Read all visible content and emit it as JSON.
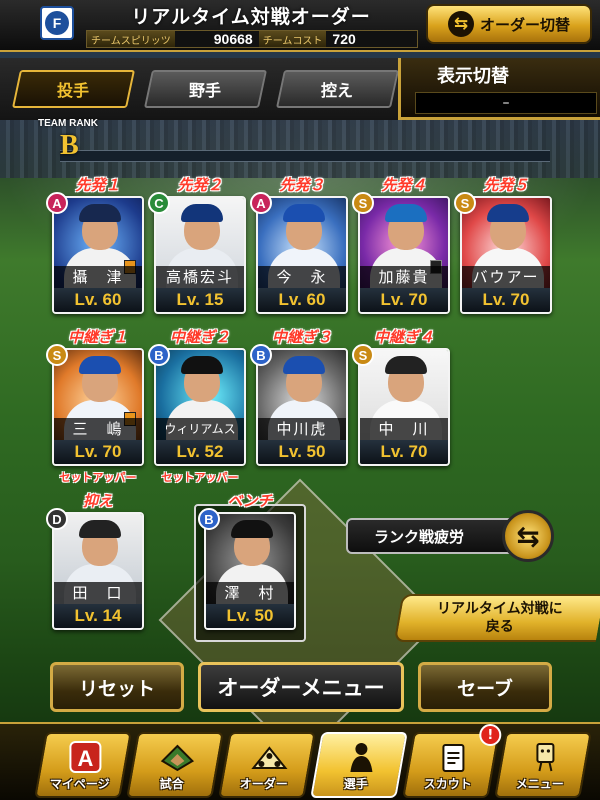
{
  "header": {
    "title": "リアルタイム対戦オーダー",
    "team_spirits_label": "チームスピリッツ",
    "team_spirits_value": "90668",
    "team_cost_label": "チームコスト",
    "team_cost_value": "720",
    "order_switch_label": "オーダー切替"
  },
  "tabs": [
    {
      "label": "投手",
      "active": true
    },
    {
      "label": "野手",
      "active": false
    },
    {
      "label": "控え",
      "active": false
    }
  ],
  "display_toggle": {
    "label": "表示切替",
    "value": "–"
  },
  "team_rank": {
    "label": "TEAM RANK",
    "value": "B"
  },
  "starters": [
    {
      "slot": "先発１",
      "name": "攝　津",
      "level": "Lv. 60",
      "rank": "A"
    },
    {
      "slot": "先発２",
      "name": "高橋宏斗",
      "level": "Lv. 15",
      "rank": "C"
    },
    {
      "slot": "先発３",
      "name": "今　永",
      "level": "Lv. 60",
      "rank": "A"
    },
    {
      "slot": "先発４",
      "name": "加藤貴",
      "level": "Lv. 70",
      "rank": "S"
    },
    {
      "slot": "先発５",
      "name": "バウアー",
      "level": "Lv. 70",
      "rank": "S"
    }
  ],
  "relievers": [
    {
      "slot": "中継ぎ１",
      "name": "三　嶋",
      "level": "Lv. 70",
      "rank": "S",
      "role": "セットアッパー"
    },
    {
      "slot": "中継ぎ２",
      "name": "ウィリアムス",
      "level": "Lv. 52",
      "rank": "B",
      "role": "セットアッパー"
    },
    {
      "slot": "中継ぎ３",
      "name": "中川虎",
      "level": "Lv. 50",
      "rank": "B",
      "role": ""
    },
    {
      "slot": "中継ぎ４",
      "name": "中　川",
      "level": "Lv. 70",
      "rank": "S",
      "role": ""
    }
  ],
  "closer": {
    "slot": "抑え",
    "name": "田　口",
    "level": "Lv. 14",
    "rank": "D"
  },
  "bench": {
    "slot": "ベンチ",
    "name": "澤　村",
    "level": "Lv. 50",
    "rank": "B"
  },
  "side_buttons": {
    "rank_fatigue": "ランク戦疲労",
    "back_to_realtime": "リアルタイム対戦に\n戻る"
  },
  "actions": {
    "reset": "リセット",
    "order_menu": "オーダーメニュー",
    "save": "セーブ"
  },
  "nav": [
    {
      "label": "マイページ",
      "icon": "mypage-icon"
    },
    {
      "label": "試合",
      "icon": "stadium-icon"
    },
    {
      "label": "オーダー",
      "icon": "order-icon"
    },
    {
      "label": "選手",
      "icon": "player-icon",
      "active": true
    },
    {
      "label": "スカウト",
      "icon": "scout-icon",
      "badge": "!"
    },
    {
      "label": "メニュー",
      "icon": "menu-icon"
    }
  ],
  "colors": {
    "accent_gold": "#f2c230",
    "slot_label_red": "#ff3b2a",
    "notification_red": "#e0241c"
  }
}
